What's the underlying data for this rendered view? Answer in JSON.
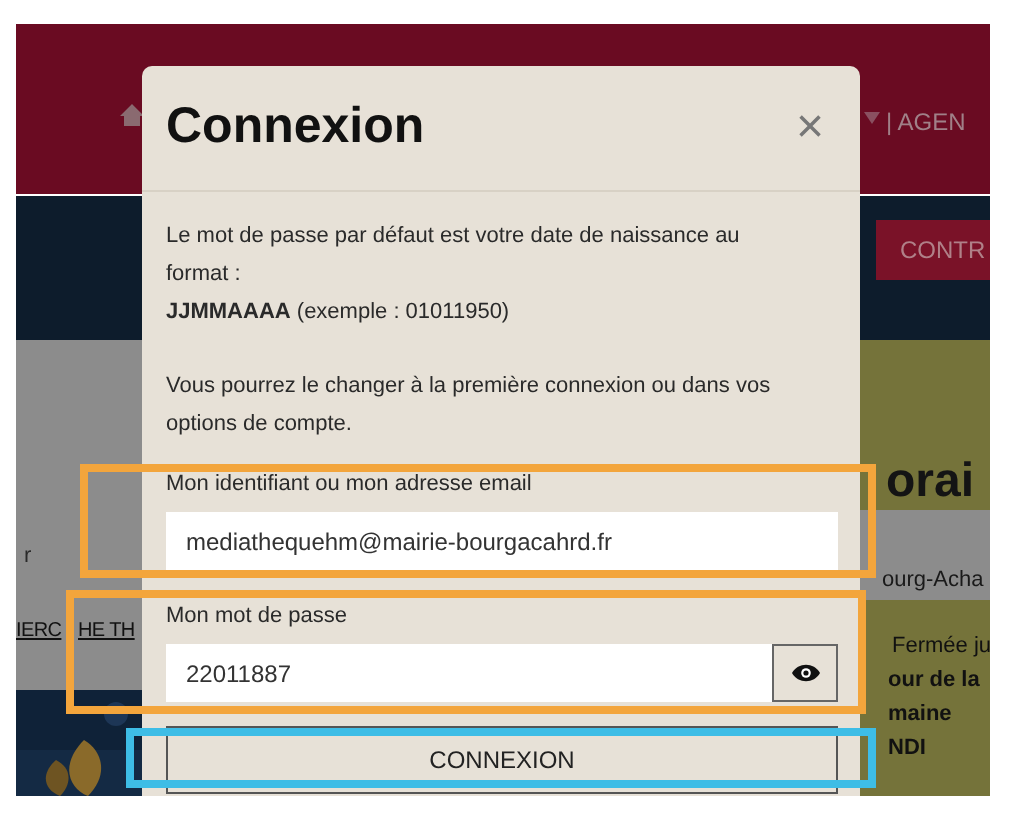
{
  "background_page": {
    "nav_link": "| AGEN",
    "action_button": "CONTR",
    "heading": "orai",
    "location": "ourg-Acha",
    "links": [
      "IERC",
      "HE TH"
    ],
    "side_letter": "r",
    "hours": [
      {
        "text": "Fermée ju",
        "bold": false
      },
      {
        "text": "our de la",
        "bold": true
      },
      {
        "text": "maine",
        "bold": true
      },
      {
        "text": "NDI",
        "bold": true
      }
    ]
  },
  "dialog": {
    "title": "Connexion",
    "close": "×",
    "intro": "Le mot de passe par défaut est votre date de naissance au format :",
    "format": "**JJMMAAAA** (exemple : 01011950)",
    "note": "Vous pourrez le changer à la première connexion ou dans vos options de compte.",
    "fields": [
      {
        "label": "Mon identifiant ou mon adresse email",
        "value": "mediathequehm@mairie-bourgacahrd.fr",
        "kind": "text"
      },
      {
        "label": "Mon mot de passe",
        "value": "22011887",
        "kind": "password"
      }
    ],
    "submit": "CONNEXION"
  },
  "highlights": [
    {
      "color": "#f3a53c"
    },
    {
      "color": "#f3a53c"
    },
    {
      "color": "#3ebde6"
    }
  ]
}
